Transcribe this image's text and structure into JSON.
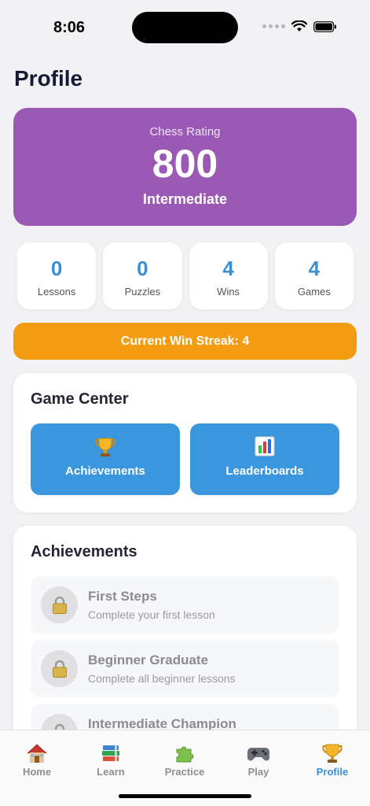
{
  "status": {
    "time": "8:06"
  },
  "page": {
    "title": "Profile"
  },
  "rating": {
    "label": "Chess Rating",
    "value": "800",
    "level": "Intermediate"
  },
  "stats": [
    {
      "value": "0",
      "label": "Lessons"
    },
    {
      "value": "0",
      "label": "Puzzles"
    },
    {
      "value": "4",
      "label": "Wins"
    },
    {
      "value": "4",
      "label": "Games"
    }
  ],
  "streak": {
    "text": "Current Win Streak: 4"
  },
  "game_center": {
    "title": "Game Center",
    "buttons": [
      {
        "label": "Achievements",
        "icon": "trophy-icon"
      },
      {
        "label": "Leaderboards",
        "icon": "bar-chart-icon"
      }
    ]
  },
  "achievements": {
    "title": "Achievements",
    "items": [
      {
        "name": "First Steps",
        "description": "Complete your first lesson",
        "icon": "lock-icon"
      },
      {
        "name": "Beginner Graduate",
        "description": "Complete all beginner lessons",
        "icon": "lock-icon"
      },
      {
        "name": "Intermediate Champion",
        "description": "",
        "icon": "lock-icon"
      }
    ]
  },
  "tabs": [
    {
      "label": "Home",
      "icon": "house-icon",
      "active": false
    },
    {
      "label": "Learn",
      "icon": "books-icon",
      "active": false
    },
    {
      "label": "Practice",
      "icon": "puzzle-icon",
      "active": false
    },
    {
      "label": "Play",
      "icon": "gamepad-icon",
      "active": false
    },
    {
      "label": "Profile",
      "icon": "trophy-icon",
      "active": true
    }
  ],
  "colors": {
    "rating_card": "#9b59b6",
    "stat_value": "#3a8fd4",
    "streak": "#f39c12",
    "game_center_button": "#3a96dd",
    "active_tab": "#3a8fd4"
  }
}
